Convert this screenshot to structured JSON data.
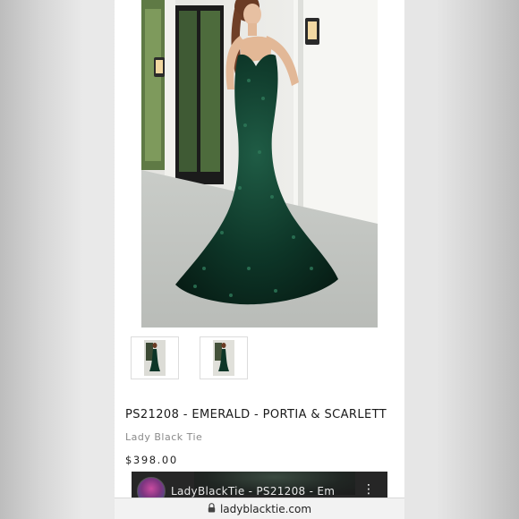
{
  "product": {
    "title": "PS21208 - EMERALD - PORTIA & SCARLETT",
    "brand": "Lady Black Tie",
    "price": "$398.00",
    "color_accent": "#0e3b2a"
  },
  "gallery": {
    "main_image": "emerald-sequin-mermaid-gown-photo",
    "thumbnails": [
      "thumbnail-front-view",
      "thumbnail-back-view"
    ]
  },
  "video": {
    "title": "LadyBlackTie - PS21208 - Em"
  },
  "browser": {
    "url": "ladyblacktie.com",
    "lock_icon": "lock-icon"
  }
}
